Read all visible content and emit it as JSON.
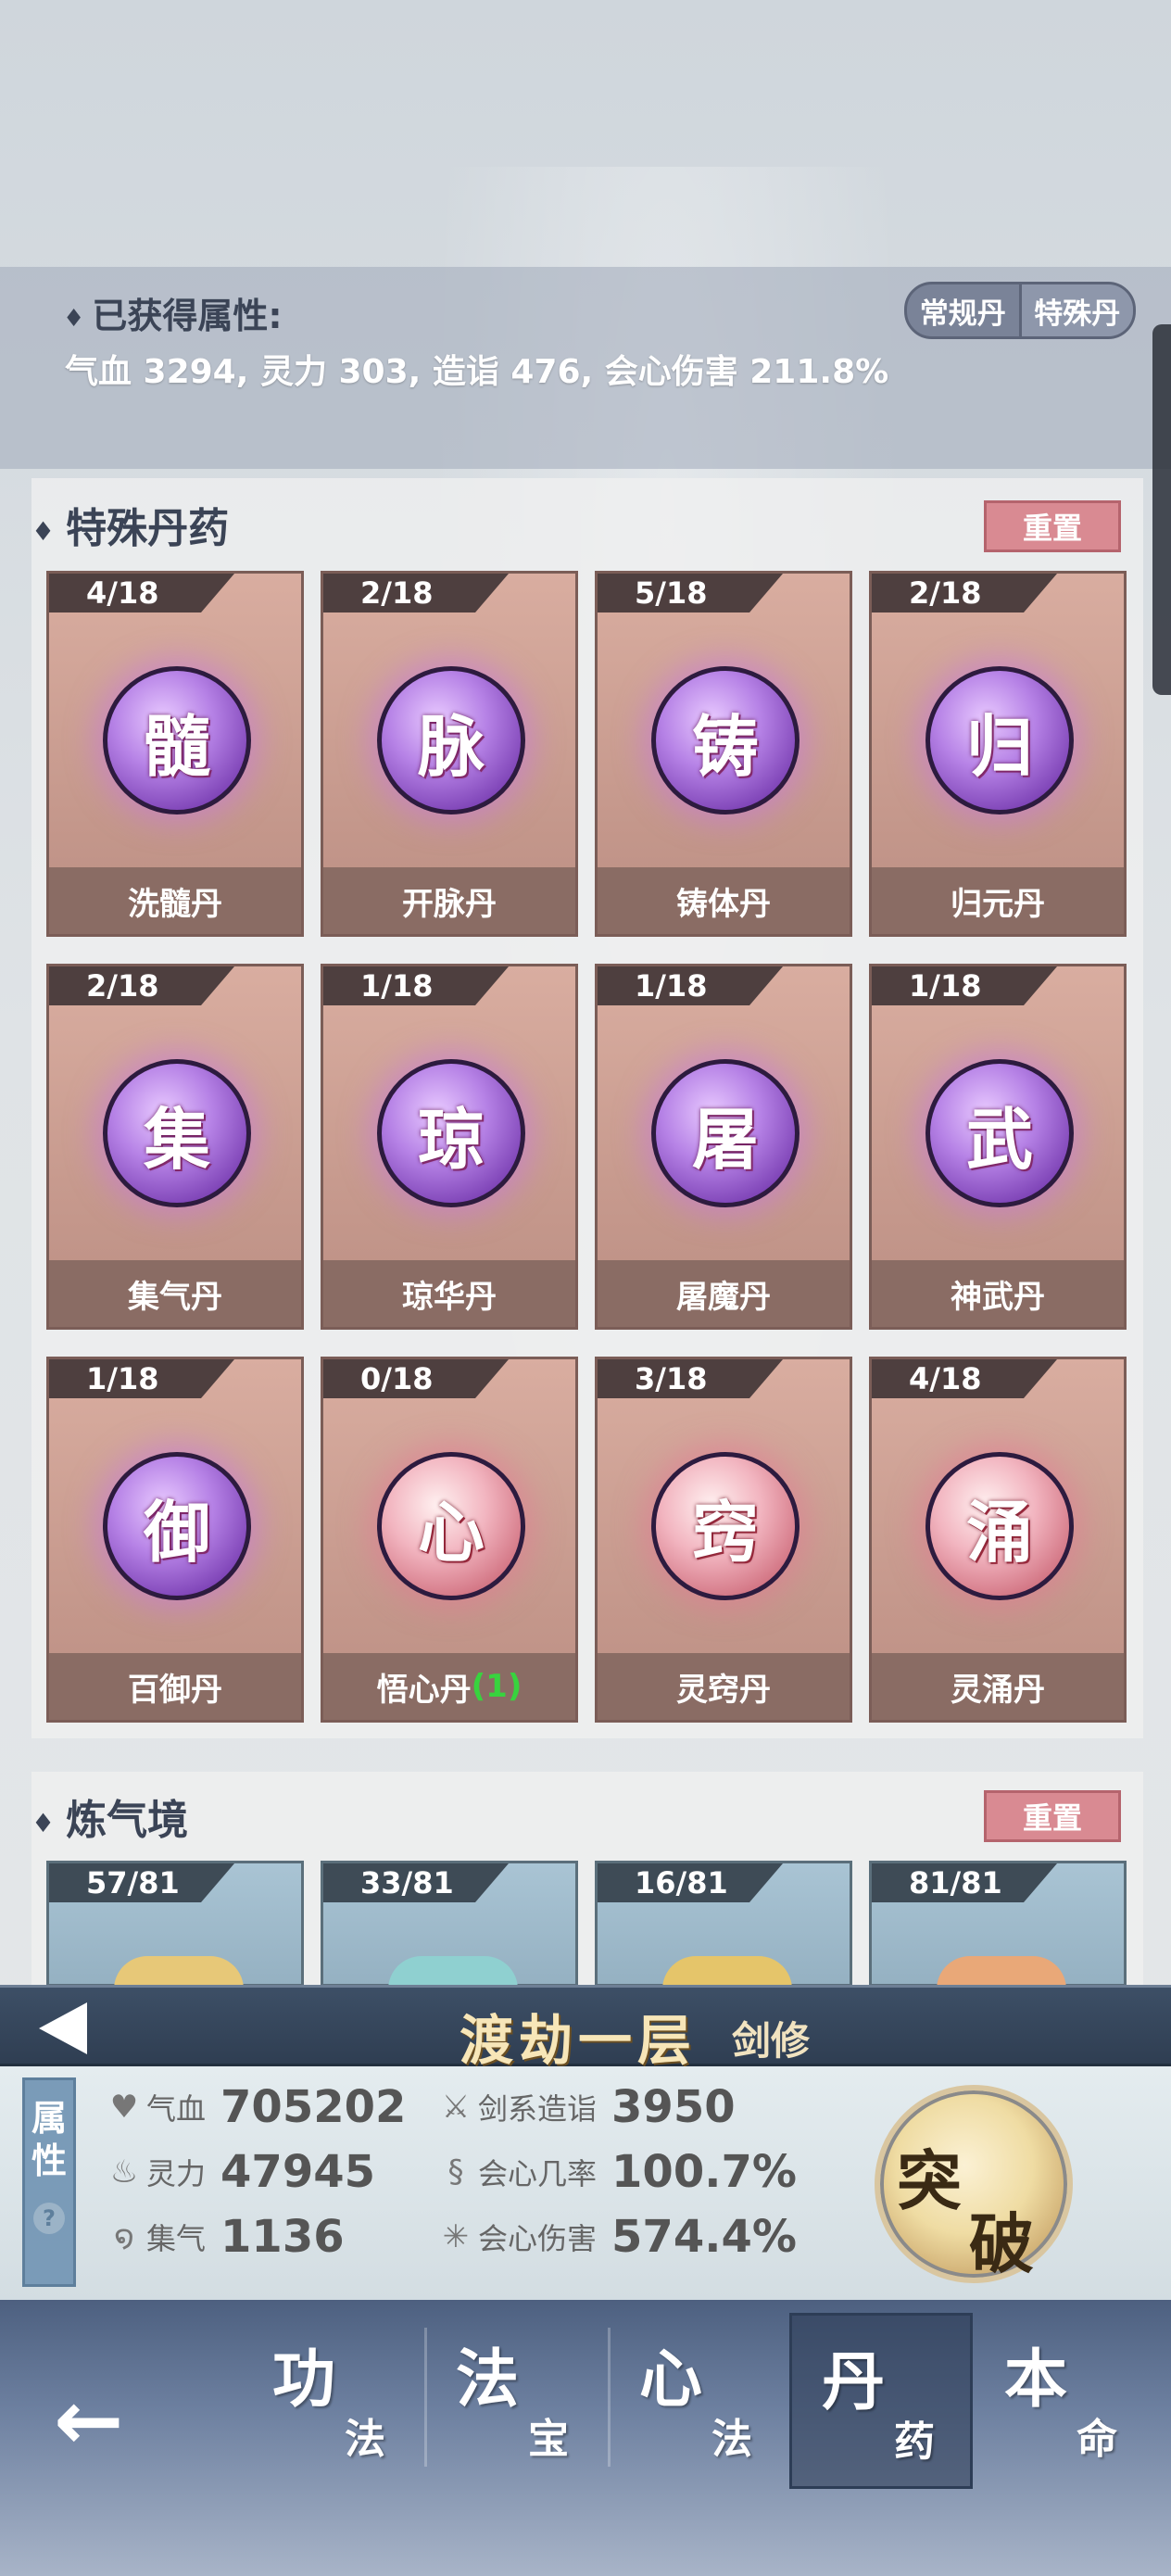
{
  "attributes": {
    "title": "已获得属性:",
    "value": "气血 3294, 灵力 303, 造诣 476, 会心伤害 211.8%",
    "toggle": [
      "常规丹",
      "特殊丹"
    ]
  },
  "special_section": {
    "title": "特殊丹药",
    "reset": "重置",
    "cards": [
      {
        "count": "4/18",
        "glyph": "髓",
        "name": "洗髓丹",
        "style": "purple"
      },
      {
        "count": "2/18",
        "glyph": "脉",
        "name": "开脉丹",
        "style": "purple"
      },
      {
        "count": "5/18",
        "glyph": "铸",
        "name": "铸体丹",
        "style": "purple"
      },
      {
        "count": "2/18",
        "glyph": "归",
        "name": "归元丹",
        "style": "purple"
      },
      {
        "count": "2/18",
        "glyph": "集",
        "name": "集气丹",
        "style": "purple"
      },
      {
        "count": "1/18",
        "glyph": "琼",
        "name": "琼华丹",
        "style": "purple"
      },
      {
        "count": "1/18",
        "glyph": "屠",
        "name": "屠魔丹",
        "style": "purple"
      },
      {
        "count": "1/18",
        "glyph": "武",
        "name": "神武丹",
        "style": "purple"
      },
      {
        "count": "1/18",
        "glyph": "御",
        "name": "百御丹",
        "style": "purple"
      },
      {
        "count": "0/18",
        "glyph": "心",
        "name": "悟心丹",
        "extra": "(1)",
        "style": "pink"
      },
      {
        "count": "3/18",
        "glyph": "窍",
        "name": "灵窍丹",
        "style": "pink"
      },
      {
        "count": "4/18",
        "glyph": "涌",
        "name": "灵涌丹",
        "style": "pink"
      }
    ]
  },
  "qi_section": {
    "title": "炼气境",
    "reset": "重置",
    "cards": [
      {
        "count": "57/81",
        "color": "#e7c878"
      },
      {
        "count": "33/81",
        "color": "#8fd0d0"
      },
      {
        "count": "16/81",
        "color": "#e5c56a"
      },
      {
        "count": "81/81",
        "color": "#e9a878"
      }
    ]
  },
  "realm": {
    "name": "渡劫一层",
    "class": "剑修"
  },
  "stats": {
    "tab_label": [
      "属",
      "性"
    ],
    "help": "?",
    "qixue": {
      "label": "气血",
      "value": "705202"
    },
    "lingli": {
      "label": "灵力",
      "value": "47945"
    },
    "jiqi": {
      "label": "集气",
      "value": "1136"
    },
    "zaoyi": {
      "label": "剑系造诣",
      "value": "3950"
    },
    "crit_rate": {
      "label": "会心几率",
      "value": "100.7%"
    },
    "crit_dmg": {
      "label": "会心伤害",
      "value": "574.4%"
    },
    "breakthrough": [
      "突",
      "破"
    ]
  },
  "nav": {
    "back": "←",
    "items": [
      {
        "big": "功",
        "small": "法"
      },
      {
        "big": "法",
        "small": "宝"
      },
      {
        "big": "心",
        "small": "法"
      },
      {
        "big": "丹",
        "small": "药"
      },
      {
        "big": "本",
        "small": "命"
      }
    ]
  }
}
